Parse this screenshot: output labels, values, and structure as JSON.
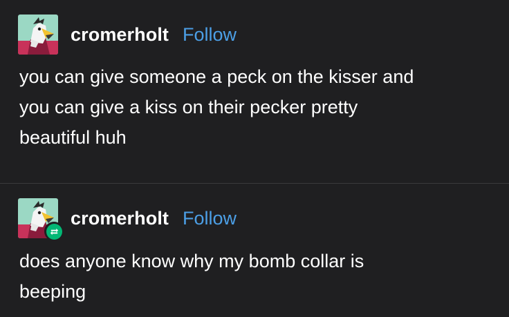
{
  "posts": [
    {
      "username": "cromerholt",
      "follow_label": "Follow",
      "avatar_icon": "bird-avatar-icon",
      "reblogged": false,
      "lines": [
        "you can give someone a peck on the kisser and",
        "you can give a kiss on their pecker pretty",
        "beautiful huh"
      ]
    },
    {
      "username": "cromerholt",
      "follow_label": "Follow",
      "avatar_icon": "bird-avatar-icon",
      "reblogged": true,
      "reblog_icon": "reblog-icon",
      "lines": [
        "does anyone know why my bomb collar is",
        "beeping"
      ]
    }
  ],
  "colors": {
    "background": "#1f1f21",
    "text": "#ffffff",
    "follow_link": "#4c9fe6",
    "reblog_badge": "#02b875",
    "divider": "#3a3a3d"
  }
}
